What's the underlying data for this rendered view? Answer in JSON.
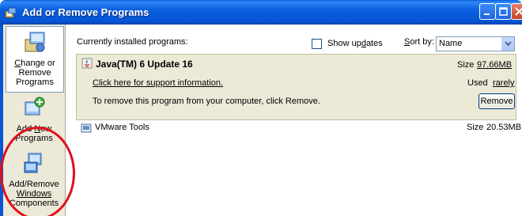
{
  "window": {
    "title": "Add or Remove Programs"
  },
  "sidebar": {
    "items": [
      {
        "line1": "Change or",
        "line2": "Remove",
        "line3": "Programs",
        "icon": "change-remove-programs-icon"
      },
      {
        "line1": "Add New",
        "line2": "Programs",
        "icon": "add-new-programs-icon"
      },
      {
        "line1": "Add/Remove",
        "line2": "Windows",
        "line3": "Components",
        "icon": "windows-components-icon"
      }
    ]
  },
  "main": {
    "header_label": "Currently installed programs:",
    "show_updates_label": "Show updates",
    "show_updates_checked": false,
    "sort_label": "Sort by:",
    "sort_value": "Name"
  },
  "programs": [
    {
      "name": "Java(TM) 6 Update 16",
      "size_label": "Size",
      "size_value": "97.66MB",
      "support_link": "Click here for support information.",
      "used_label": "Used",
      "used_value": "rarely",
      "remove_text": "To remove this program from your computer, click Remove.",
      "remove_button": "Remove"
    },
    {
      "name": "VMware Tools",
      "size_label": "Size",
      "size_value": "20.53MB"
    }
  ],
  "colors": {
    "titlebar": "#0754d4",
    "selected_row": "#ecead7",
    "annotation": "#e0101a"
  }
}
